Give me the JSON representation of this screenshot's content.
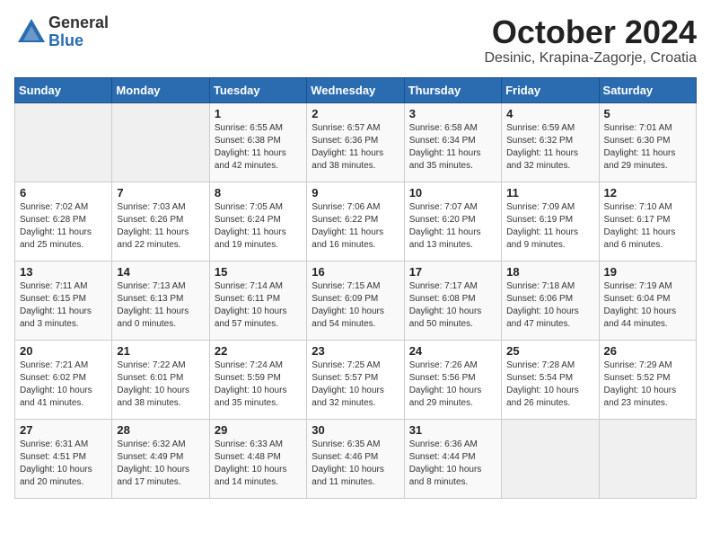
{
  "header": {
    "logo_general": "General",
    "logo_blue": "Blue",
    "month_title": "October 2024",
    "location": "Desinic, Krapina-Zagorje, Croatia"
  },
  "calendar": {
    "days_of_week": [
      "Sunday",
      "Monday",
      "Tuesday",
      "Wednesday",
      "Thursday",
      "Friday",
      "Saturday"
    ],
    "weeks": [
      [
        {
          "day": "",
          "empty": true
        },
        {
          "day": "",
          "empty": true
        },
        {
          "day": "1",
          "sunrise": "6:55 AM",
          "sunset": "6:38 PM",
          "daylight": "11 hours and 42 minutes."
        },
        {
          "day": "2",
          "sunrise": "6:57 AM",
          "sunset": "6:36 PM",
          "daylight": "11 hours and 38 minutes."
        },
        {
          "day": "3",
          "sunrise": "6:58 AM",
          "sunset": "6:34 PM",
          "daylight": "11 hours and 35 minutes."
        },
        {
          "day": "4",
          "sunrise": "6:59 AM",
          "sunset": "6:32 PM",
          "daylight": "11 hours and 32 minutes."
        },
        {
          "day": "5",
          "sunrise": "7:01 AM",
          "sunset": "6:30 PM",
          "daylight": "11 hours and 29 minutes."
        }
      ],
      [
        {
          "day": "6",
          "sunrise": "7:02 AM",
          "sunset": "6:28 PM",
          "daylight": "11 hours and 25 minutes."
        },
        {
          "day": "7",
          "sunrise": "7:03 AM",
          "sunset": "6:26 PM",
          "daylight": "11 hours and 22 minutes."
        },
        {
          "day": "8",
          "sunrise": "7:05 AM",
          "sunset": "6:24 PM",
          "daylight": "11 hours and 19 minutes."
        },
        {
          "day": "9",
          "sunrise": "7:06 AM",
          "sunset": "6:22 PM",
          "daylight": "11 hours and 16 minutes."
        },
        {
          "day": "10",
          "sunrise": "7:07 AM",
          "sunset": "6:20 PM",
          "daylight": "11 hours and 13 minutes."
        },
        {
          "day": "11",
          "sunrise": "7:09 AM",
          "sunset": "6:19 PM",
          "daylight": "11 hours and 9 minutes."
        },
        {
          "day": "12",
          "sunrise": "7:10 AM",
          "sunset": "6:17 PM",
          "daylight": "11 hours and 6 minutes."
        }
      ],
      [
        {
          "day": "13",
          "sunrise": "7:11 AM",
          "sunset": "6:15 PM",
          "daylight": "11 hours and 3 minutes."
        },
        {
          "day": "14",
          "sunrise": "7:13 AM",
          "sunset": "6:13 PM",
          "daylight": "11 hours and 0 minutes."
        },
        {
          "day": "15",
          "sunrise": "7:14 AM",
          "sunset": "6:11 PM",
          "daylight": "10 hours and 57 minutes."
        },
        {
          "day": "16",
          "sunrise": "7:15 AM",
          "sunset": "6:09 PM",
          "daylight": "10 hours and 54 minutes."
        },
        {
          "day": "17",
          "sunrise": "7:17 AM",
          "sunset": "6:08 PM",
          "daylight": "10 hours and 50 minutes."
        },
        {
          "day": "18",
          "sunrise": "7:18 AM",
          "sunset": "6:06 PM",
          "daylight": "10 hours and 47 minutes."
        },
        {
          "day": "19",
          "sunrise": "7:19 AM",
          "sunset": "6:04 PM",
          "daylight": "10 hours and 44 minutes."
        }
      ],
      [
        {
          "day": "20",
          "sunrise": "7:21 AM",
          "sunset": "6:02 PM",
          "daylight": "10 hours and 41 minutes."
        },
        {
          "day": "21",
          "sunrise": "7:22 AM",
          "sunset": "6:01 PM",
          "daylight": "10 hours and 38 minutes."
        },
        {
          "day": "22",
          "sunrise": "7:24 AM",
          "sunset": "5:59 PM",
          "daylight": "10 hours and 35 minutes."
        },
        {
          "day": "23",
          "sunrise": "7:25 AM",
          "sunset": "5:57 PM",
          "daylight": "10 hours and 32 minutes."
        },
        {
          "day": "24",
          "sunrise": "7:26 AM",
          "sunset": "5:56 PM",
          "daylight": "10 hours and 29 minutes."
        },
        {
          "day": "25",
          "sunrise": "7:28 AM",
          "sunset": "5:54 PM",
          "daylight": "10 hours and 26 minutes."
        },
        {
          "day": "26",
          "sunrise": "7:29 AM",
          "sunset": "5:52 PM",
          "daylight": "10 hours and 23 minutes."
        }
      ],
      [
        {
          "day": "27",
          "sunrise": "6:31 AM",
          "sunset": "4:51 PM",
          "daylight": "10 hours and 20 minutes."
        },
        {
          "day": "28",
          "sunrise": "6:32 AM",
          "sunset": "4:49 PM",
          "daylight": "10 hours and 17 minutes."
        },
        {
          "day": "29",
          "sunrise": "6:33 AM",
          "sunset": "4:48 PM",
          "daylight": "10 hours and 14 minutes."
        },
        {
          "day": "30",
          "sunrise": "6:35 AM",
          "sunset": "4:46 PM",
          "daylight": "10 hours and 11 minutes."
        },
        {
          "day": "31",
          "sunrise": "6:36 AM",
          "sunset": "4:44 PM",
          "daylight": "10 hours and 8 minutes."
        },
        {
          "day": "",
          "empty": true
        },
        {
          "day": "",
          "empty": true
        }
      ]
    ]
  }
}
